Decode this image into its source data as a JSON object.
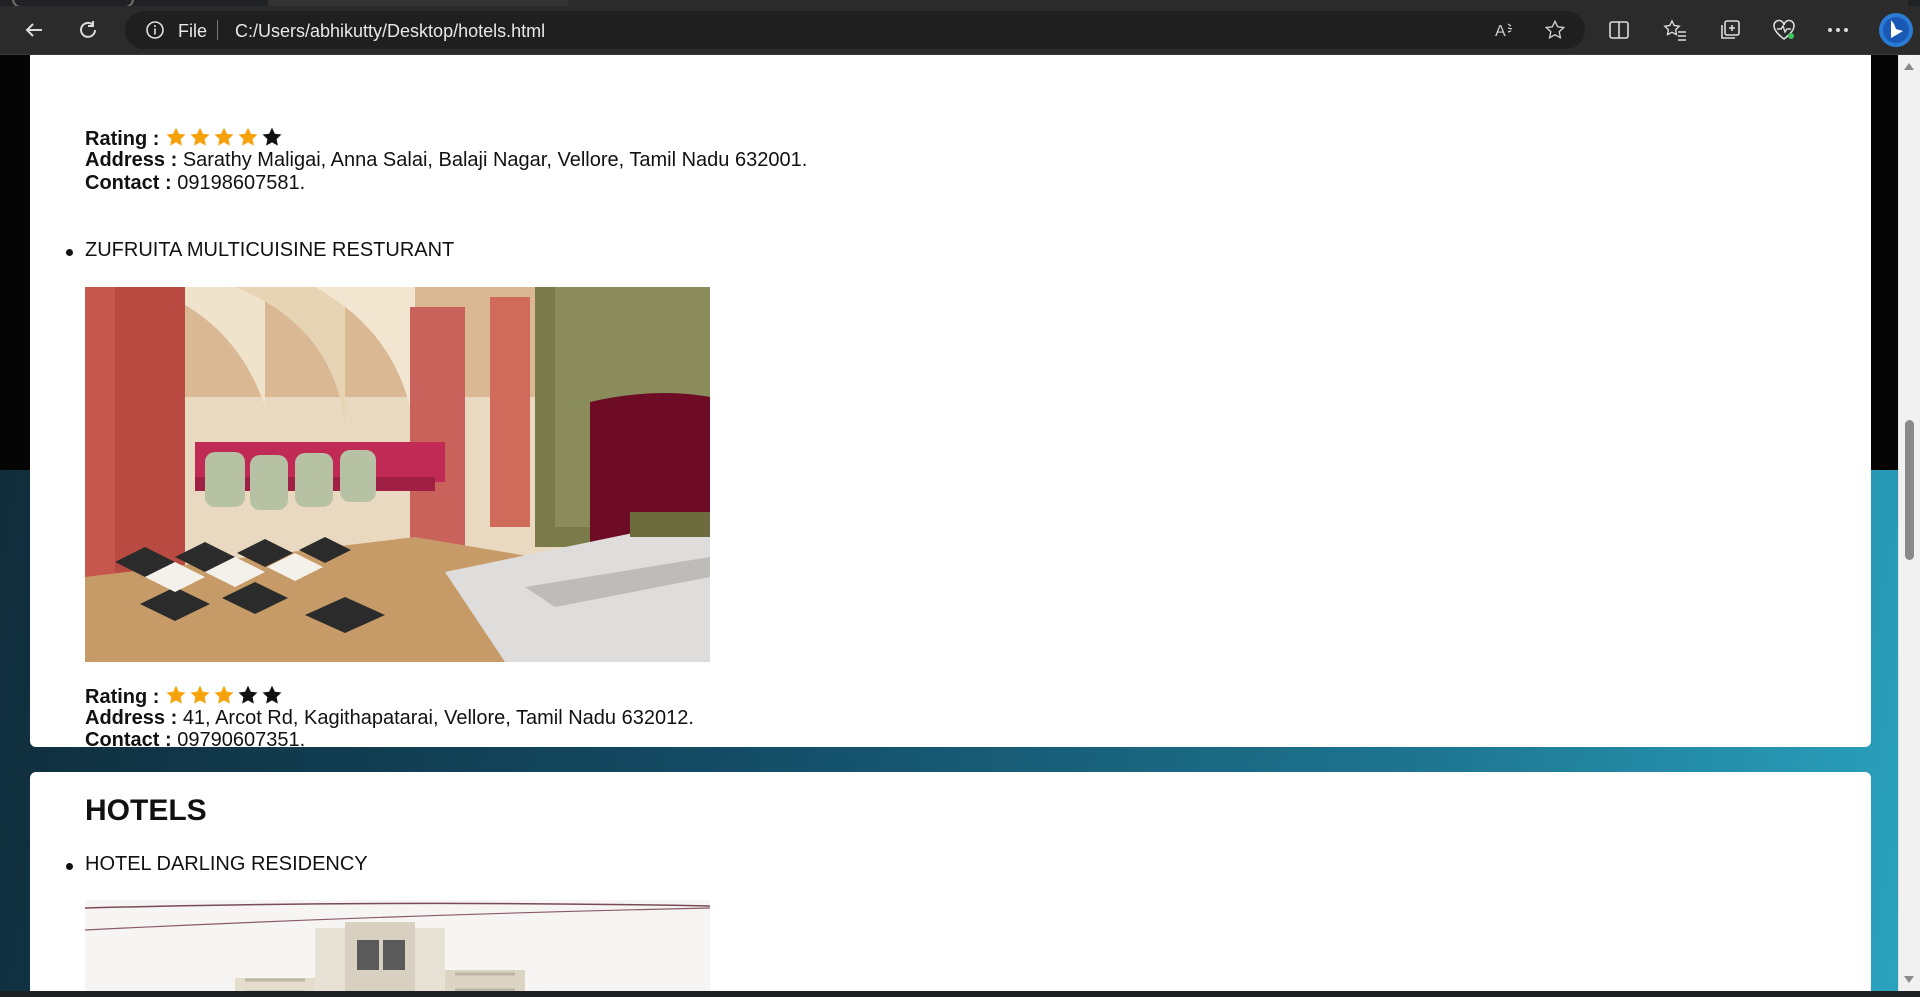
{
  "browser": {
    "scheme_label": "File",
    "url": "C:/Users/abhikutty/Desktop/hotels.html",
    "icons": [
      "back-icon",
      "refresh-icon",
      "info-icon",
      "read-aloud-icon",
      "favorite-star-icon",
      "split-screen-icon",
      "favorites-icon",
      "collections-icon",
      "browser-essentials-icon",
      "more-icon",
      "bing-copilot-icon"
    ]
  },
  "restaurant_prev": {
    "rating_label": "Rating :",
    "rating": {
      "filled": 4,
      "total": 5
    },
    "address_label": "Address :",
    "address": "Sarathy Maligai, Anna Salai, Balaji Nagar, Vellore, Tamil Nadu 632001.",
    "contact_label": "Contact :",
    "contact": "09198607581."
  },
  "restaurant": {
    "name": "ZUFRUITA MULTICUISINE RESTURANT",
    "rating_label": "Rating :",
    "rating": {
      "filled": 3,
      "total": 5
    },
    "address_label": "Address :",
    "address": "41, Arcot Rd, Kagithapatarai, Vellore, Tamil Nadu 632012.",
    "contact_label": "Contact :",
    "contact": "09790607351."
  },
  "hotels": {
    "heading": "HOTELS",
    "first_item": "HOTEL DARLING RESIDENCY"
  },
  "colors": {
    "star_filled": "#f5a20b",
    "star_empty": "#111111",
    "page_bg_gradient": [
      "#0f2a37",
      "#2aa2be"
    ]
  }
}
